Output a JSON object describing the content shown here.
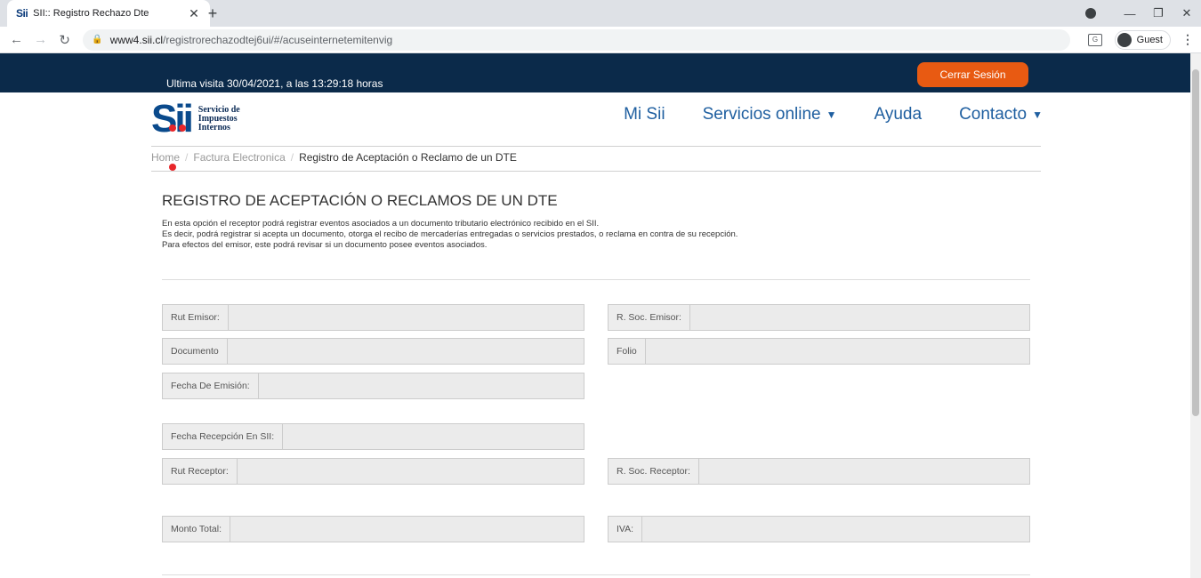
{
  "browser": {
    "tab_favicon": "Sii",
    "tab_title": "SII:: Registro Rechazo Dte",
    "tab_close": "✕",
    "new_tab": "+",
    "url_host": "www4.sii.cl",
    "url_path": "/registrorechazodtej6ui/#/acuseinternetemitenvig",
    "guest_label": "Guest",
    "back": "←",
    "forward": "→",
    "reload": "↻",
    "minimize": "—",
    "maximize": "❐",
    "close": "✕",
    "kebab": "⋮"
  },
  "topbar": {
    "last_visit": "Ultima visita 30/04/2021, a las 13:29:18 horas",
    "logout_label": "Cerrar Sesión"
  },
  "logo": {
    "mark": "Sii",
    "line1": "Servicio de",
    "line2": "Impuestos",
    "line3": "Internos"
  },
  "nav": {
    "items": [
      {
        "label": "Mi Sii"
      },
      {
        "label": "Servicios online",
        "caret": "▼"
      },
      {
        "label": "Ayuda"
      },
      {
        "label": "Contacto",
        "caret": "▼"
      }
    ]
  },
  "breadcrumb": {
    "home": "Home",
    "section": "Factura Electronica",
    "current": "Registro de Aceptación o Reclamo de un DTE",
    "separator": "/"
  },
  "page": {
    "title": "REGISTRO DE ACEPTACIÓN O RECLAMOS DE UN DTE",
    "desc1": "En esta opción el receptor podrá registrar eventos asociados a un documento tributario electrónico recibido en el SII.",
    "desc2": "Es decir, podrá registrar si acepta un documento, otorga el recibo de mercaderías entregadas o servicios prestados, o reclama en contra de su recepción.",
    "desc3": "Para efectos del emisor, este podrá revisar si un documento posee eventos asociados."
  },
  "form": {
    "rut_emisor": "Rut Emisor:",
    "rsoc_emisor": "R. Soc. Emisor:",
    "documento": "Documento",
    "folio": "Folio",
    "fecha_emision": "Fecha De Emisión:",
    "fecha_recepcion": "Fecha Recepción En SII:",
    "rut_receptor": "Rut Receptor:",
    "rsoc_receptor": "R. Soc. Receptor:",
    "monto_total": "Monto Total:",
    "iva": "IVA:"
  }
}
